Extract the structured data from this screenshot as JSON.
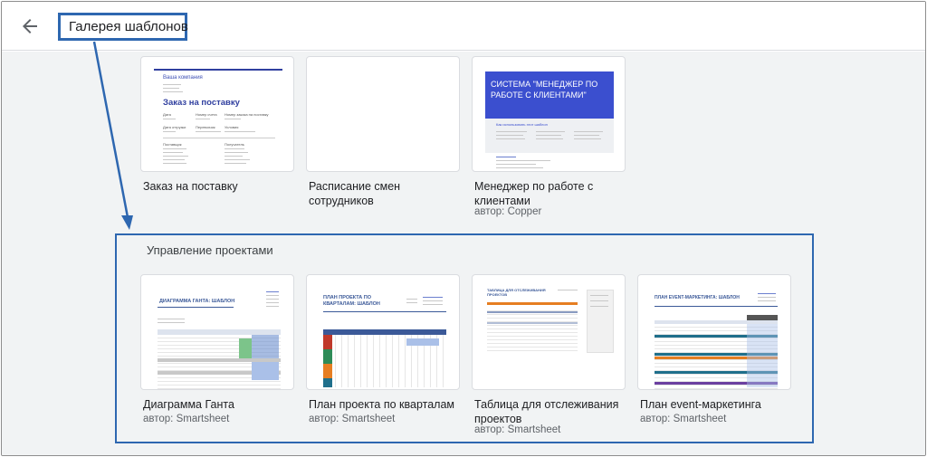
{
  "header": {
    "title": "Галерея шаблонов",
    "back_icon": "arrow-back-icon"
  },
  "colors": {
    "annotation_blue": "#2e67b0",
    "background": "#f1f3f4",
    "author_text": "#5f6368"
  },
  "top_templates": [
    {
      "title": "Заказ на поставку",
      "author": "",
      "thumb": {
        "company": "Ваша компания",
        "doc_title": "Заказ на поставку",
        "field_date": "Дата",
        "field_order_num": "Номер счета",
        "field_order_id": "Номер заказа на поставку",
        "field_delivery": "Дата отгрузки",
        "field_carrier": "Перевозчик",
        "field_terms": "Условия",
        "field_supplier": "Поставщик",
        "field_recipient": "Получатель"
      }
    },
    {
      "title": "Расписание смен сотрудников",
      "author": ""
    },
    {
      "title": "Менеджер по работе с клиентами",
      "author": "автор: Copper",
      "thumb": {
        "banner": "СИСТЕМА \"МЕНЕДЖЕР ПО РАБОТЕ С КЛИЕНТАМИ\"",
        "subhead": "Как использовать этот шаблон"
      }
    }
  ],
  "section": {
    "title": "Управление проектами",
    "templates": [
      {
        "title": "Диаграмма Ганта",
        "author": "автор: Smartsheet",
        "thumb_title": "ДИАГРАММА ГАНТА: ШАБЛОН"
      },
      {
        "title": "План проекта по кварталам",
        "author": "автор: Smartsheet",
        "thumb_title": "ПЛАН ПРОЕКТА ПО КВАРТАЛАМ: ШАБЛОН"
      },
      {
        "title": "Таблица для отслеживания проектов",
        "author": "автор: Smartsheet",
        "thumb_title": "ТАБЛИЦА ДЛЯ ОТСЛЕЖИВАНИЯ ПРОЕКТОВ"
      },
      {
        "title": "План event-маркетинга",
        "author": "автор: Smartsheet",
        "thumb_title": "ПЛАН EVENT-МАРКЕТИНГА: ШАБЛОН"
      }
    ]
  }
}
